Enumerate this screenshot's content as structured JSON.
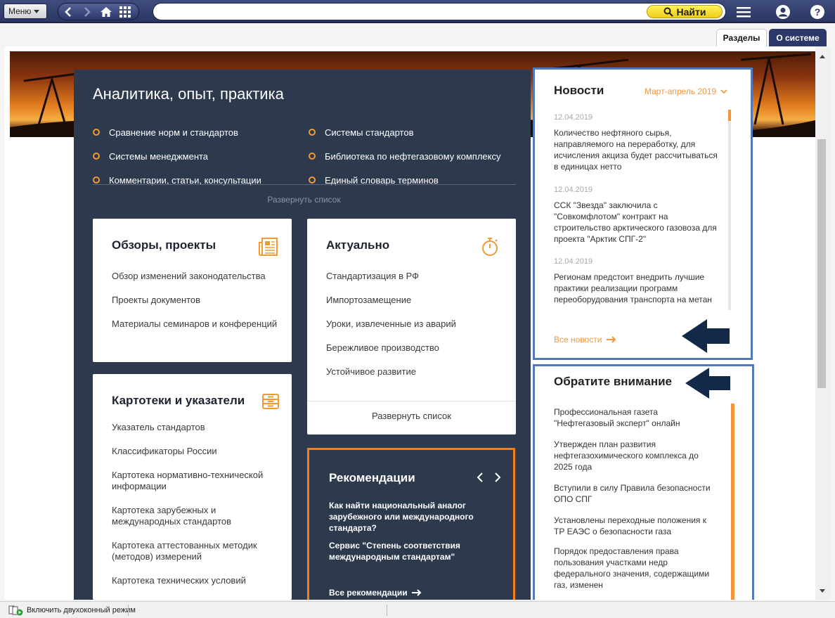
{
  "toolbar": {
    "menu_label": "Меню",
    "find_label": "Найти",
    "search_value": ""
  },
  "tabs": [
    {
      "label": "Разделы",
      "active": true
    },
    {
      "label": "О системе",
      "active": false
    }
  ],
  "analytics": {
    "title": "Аналитика, опыт, практика",
    "left_links": [
      "Сравнение норм и стандартов",
      "Системы менеджмента",
      "Комментарии, статьи, консультации"
    ],
    "right_links": [
      "Системы стандартов",
      "Библиотека по нефтегазовому комплексу",
      "Единый словарь терминов"
    ],
    "expand_label": "Развернуть список"
  },
  "reviews": {
    "title": "Обзоры, проекты",
    "links": [
      "Обзор изменений законодательства",
      "Проекты документов",
      "Материалы семинаров и конференций"
    ]
  },
  "actual": {
    "title": "Актуально",
    "links": [
      "Стандартизация в РФ",
      "Импортозамещение",
      "Уроки, извлеченные из аварий",
      "Бережливое производство",
      "Устойчивое развитие"
    ],
    "expand_label": "Развернуть список"
  },
  "catalogs": {
    "title": "Картотеки и указатели",
    "links": [
      "Указатель стандартов",
      "Классификаторы России",
      "Картотека нормативно-технической информации",
      "Картотека зарубежных и международных стандартов",
      "Картотека аттестованных методик (методов) измерений",
      "Картотека технических условий"
    ]
  },
  "recommendations": {
    "title": "Рекомендации",
    "items": [
      "Как найти национальный аналог зарубежного или международного стандарта?",
      "Сервис \"Степень соответствия международным стандартам\""
    ],
    "all_label": "Все рекомендации"
  },
  "news": {
    "title": "Новости",
    "period": "Март-апрель 2019",
    "items": [
      {
        "date": "12.04.2019",
        "text": "Количество нефтяного сырья, направляемого на переработку, для исчисления акциза будет рассчитываться в единицах нетто"
      },
      {
        "date": "12.04.2019",
        "text": "ССК \"Звезда\" заключила с \"Совкомфлотом\" контракт на строительство арктического газовоза для проекта \"Арктик СПГ-2\""
      },
      {
        "date": "12.04.2019",
        "text": "Регионам предстоит внедрить лучшие практики реализации программ переоборудования транспорта на метан"
      }
    ],
    "all_label": "Все новости"
  },
  "attention": {
    "title": "Обратите внимание",
    "items": [
      "Профессиональная газета \"Нефтегазовый эксперт\" онлайн",
      "Утвержден план развития нефтегазохимического комплекса до 2025 года",
      "Вступили в силу Правила безопасности ОПО СПГ",
      "Установлены переходные положения к ТР ЕАЭС о безопасности газа",
      "Порядок предоставления права пользования участками недр федерального значения, содержащими газ, изменен"
    ]
  },
  "statusbar": {
    "dual_window_label": "Включить двухоконный режим"
  },
  "colors": {
    "toolbar": "#2b3764",
    "accent": "#f3953a",
    "dark_panel": "#2d3a4d",
    "annotation": "#5178b8",
    "reco_border": "#f47f1a",
    "find_button": "#f0cc1a"
  }
}
